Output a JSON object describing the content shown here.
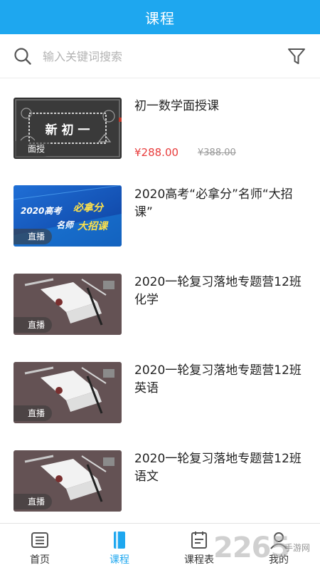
{
  "header": {
    "title": "课程"
  },
  "search": {
    "placeholder": "输入关键词搜索"
  },
  "courses": [
    {
      "title": "初一数学面授课",
      "badge": "面授",
      "thumb_text": "新 初 一",
      "price": "¥288.00",
      "original_price": "¥388.00"
    },
    {
      "title": "2020高考“必拿分”名师“大招课”",
      "badge": "直播",
      "thumb_text_1": "2020高考",
      "thumb_text_2": "必拿分",
      "thumb_text_3": "名师",
      "thumb_text_4": "大招课"
    },
    {
      "title": "2020一轮复习落地专题营12班化学",
      "badge": "直播"
    },
    {
      "title": "2020一轮复习落地专题营12班英语",
      "badge": "直播"
    },
    {
      "title": "2020一轮复习落地专题营12班语文",
      "badge": "直播"
    }
  ],
  "tabs": [
    {
      "label": "首页",
      "icon": "list-icon"
    },
    {
      "label": "课程",
      "icon": "book-icon"
    },
    {
      "label": "课程表",
      "icon": "schedule-icon"
    },
    {
      "label": "我的",
      "icon": "user-icon"
    }
  ],
  "active_tab": "课程",
  "watermark": {
    "number": "2265",
    "text": "手游网"
  },
  "colors": {
    "accent": "#1ea7ef",
    "price": "#e83c3c"
  }
}
